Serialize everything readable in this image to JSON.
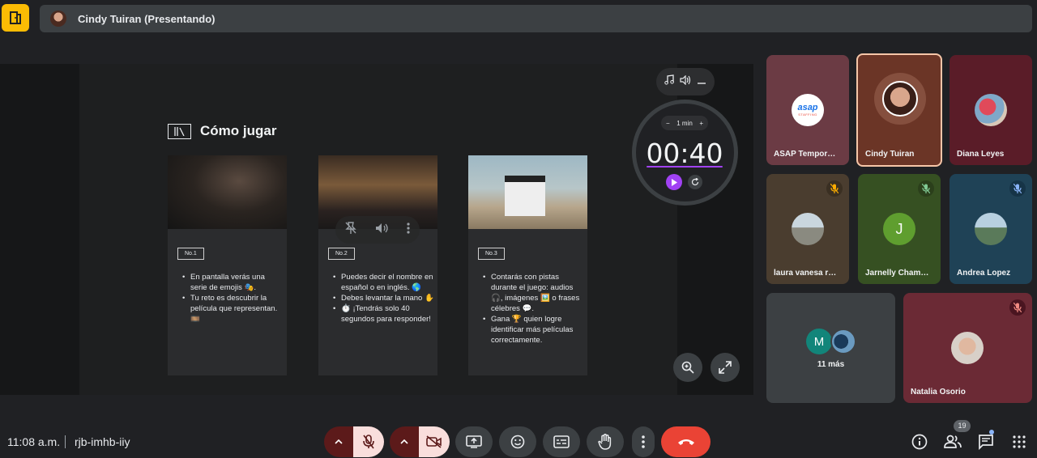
{
  "meeting": {
    "presenter_banner": "Cindy Tuiran (Presentando)",
    "time": "11:08 a.m.",
    "code": "rjb-imhb-iiy"
  },
  "slide": {
    "title": "Cómo jugar",
    "cards": [
      {
        "badge": "No.1",
        "bullets": [
          "En pantalla verás una serie de emojis 🎭.",
          "Tu reto es descubrir la película que representan. 🎞️"
        ]
      },
      {
        "badge": "No.2",
        "bullets": [
          "Puedes decir el nombre en español o en inglés. 🌎",
          "Debes levantar la mano ✋",
          "⏱️ ¡Tendrás solo 40 segundos para responder!"
        ]
      },
      {
        "badge": "No.3",
        "bullets": [
          "Contarás con pistas durante el juego: audios 🎧, imágenes 🖼️ o frases célebres 💬.",
          "Gana 🏆 quien logre identificar más películas correctamente."
        ]
      }
    ]
  },
  "timer": {
    "duration_label": "1 min",
    "minus": "−",
    "plus": "+",
    "display": "00:40"
  },
  "participants": [
    {
      "name": "ASAP Tempor…",
      "avatar": "asap-logo",
      "logo_text": "asap",
      "logo_sub": "STAFFING"
    },
    {
      "name": "Cindy Tuiran",
      "avatar": "photo",
      "active_speaker": true
    },
    {
      "name": "Diana Leyes",
      "avatar": "photo"
    },
    {
      "name": "laura vanesa r…",
      "avatar": "photo",
      "muted": true
    },
    {
      "name": "Jarnelly Cham…",
      "avatar": "letter",
      "initial": "J",
      "muted": true
    },
    {
      "name": "Andrea Lopez",
      "avatar": "photo",
      "muted": true
    },
    {
      "name": "11 más",
      "avatar": "group",
      "initial": "M"
    },
    {
      "name": "Natalia Osorio",
      "avatar": "photo",
      "muted": true
    }
  ],
  "toolbar": {
    "people_count": "19"
  },
  "colors": {
    "end_call": "#ea4335",
    "timer_accent": "#a142f4",
    "app_icon": "#fbbc04",
    "muted_control_bg": "#f9dedc"
  }
}
